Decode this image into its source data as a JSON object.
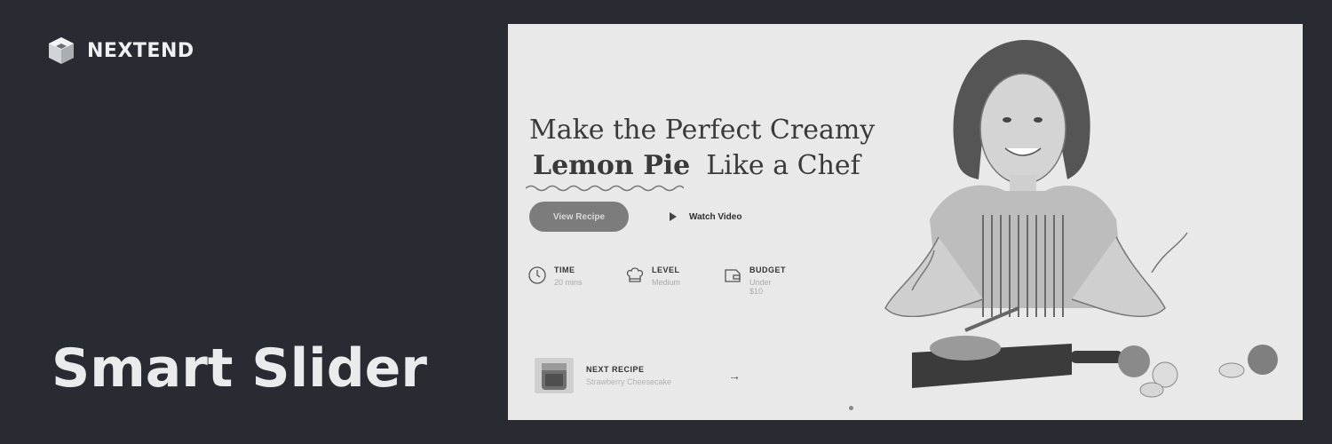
{
  "brand": {
    "name": "NEXTEND",
    "logo_icon": "cube-logo-icon"
  },
  "product": {
    "title": "Smart Slider"
  },
  "slide": {
    "headline_line1": "Make the Perfect Creamy",
    "headline_strong": "Lemon Pie",
    "headline_rest": "Like a Chef",
    "cta_primary": "View Recipe",
    "cta_secondary": "Watch Video",
    "meta": [
      {
        "label": "TIME",
        "value": "20 mins",
        "icon": "clock-icon"
      },
      {
        "label": "LEVEL",
        "value": "Medium",
        "icon": "chef-hat-icon"
      },
      {
        "label": "BUDGET",
        "value": "Under $10",
        "icon": "wallet-icon"
      }
    ],
    "next_recipe": {
      "label": "NEXT RECIPE",
      "subtitle": "Strawberry Cheesecake"
    },
    "colors": {
      "background": "#e9e9e9",
      "button": "#7c7c7c",
      "text": "#3a3a3a"
    }
  },
  "page_background": "#282c32"
}
